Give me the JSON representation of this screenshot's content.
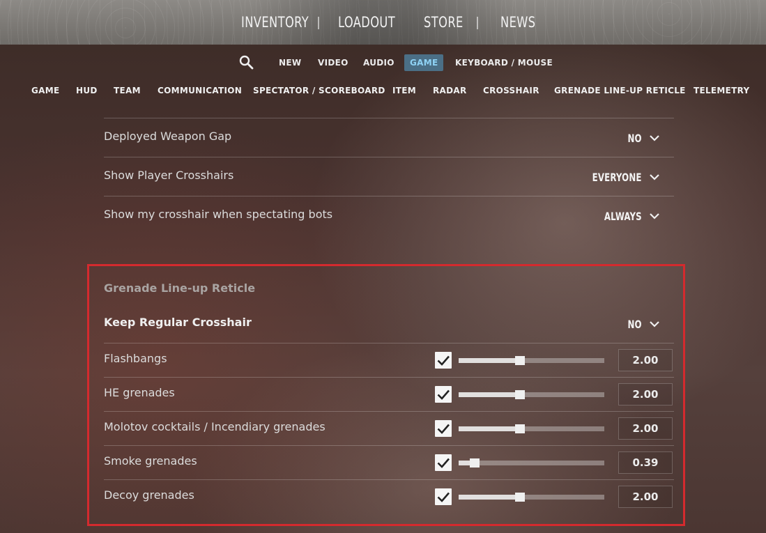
{
  "top_nav": {
    "items": [
      "INVENTORY",
      "LOADOUT",
      "STORE",
      "NEWS"
    ]
  },
  "sub_nav": {
    "search_icon": "search-icon",
    "items": [
      "NEW",
      "VIDEO",
      "AUDIO",
      "GAME",
      "KEYBOARD / MOUSE"
    ],
    "active": "GAME"
  },
  "category_tabs": [
    "GAME",
    "HUD",
    "TEAM",
    "COMMUNICATION",
    "SPECTATOR / SCOREBOARD",
    "ITEM",
    "RADAR",
    "CROSSHAIR",
    "GRENADE LINE-UP RETICLE",
    "TELEMETRY"
  ],
  "settings": [
    {
      "label": "Deployed Weapon Gap",
      "value": "NO"
    },
    {
      "label": "Show Player Crosshairs",
      "value": "EVERYONE"
    },
    {
      "label": "Show my crosshair when spectating bots",
      "value": "ALWAYS"
    }
  ],
  "grenade_section": {
    "title": "Grenade Line-up Reticle",
    "keep_regular": {
      "label": "Keep Regular Crosshair",
      "value": "NO"
    },
    "rows": [
      {
        "label": "Flashbangs",
        "checked": true,
        "level": 0.42,
        "value": "2.00"
      },
      {
        "label": "HE grenades",
        "checked": true,
        "level": 0.42,
        "value": "2.00"
      },
      {
        "label": "Molotov cocktails / Incendiary grenades",
        "checked": true,
        "level": 0.42,
        "value": "2.00"
      },
      {
        "label": "Smoke grenades",
        "checked": true,
        "level": 0.11,
        "value": "0.39"
      },
      {
        "label": "Decoy grenades",
        "checked": true,
        "level": 0.42,
        "value": "2.00"
      }
    ]
  },
  "colors": {
    "active_tab_bg": "#4b6f86",
    "active_tab_text": "#8fd3f5",
    "highlight_border": "#d42a2e"
  }
}
